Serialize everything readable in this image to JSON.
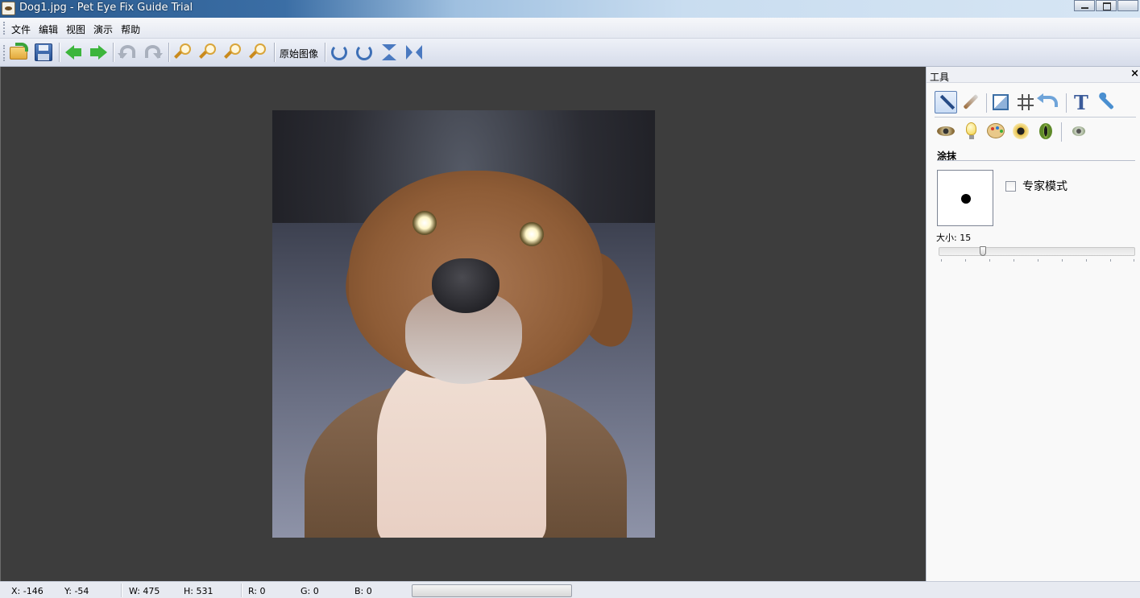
{
  "window": {
    "title": "Dog1.jpg - Pet Eye Fix Guide Trial",
    "app_icon": "eye-icon"
  },
  "menu": {
    "items": [
      "文件",
      "编辑",
      "视图",
      "演示",
      "帮助"
    ]
  },
  "toolbar": {
    "original_image_label": "原始图像",
    "icons": [
      "open-folder-icon",
      "save-disk-icon",
      "arrow-left-icon",
      "arrow-right-icon",
      "undo-icon",
      "redo-icon",
      "zoom-in-icon",
      "zoom-out-icon",
      "zoom-fit-icon",
      "zoom-actual-icon",
      "rotate-right-icon",
      "rotate-left-icon",
      "flip-vertical-icon",
      "flip-horizontal-icon"
    ]
  },
  "canvas": {
    "background": "#3d3d3d"
  },
  "panel": {
    "title": "工具",
    "close_glyph": "×",
    "section_title": "涂抹",
    "expert_mode_label": "专家模式",
    "expert_mode_checked": false,
    "size_label": "大小: 15",
    "size_value": 15
  },
  "status": {
    "x": "X: -146",
    "y": "Y: -54",
    "w": "W: 475",
    "h": "H: 531",
    "r": "R: 0",
    "g": "G: 0",
    "b": "B: 0"
  }
}
